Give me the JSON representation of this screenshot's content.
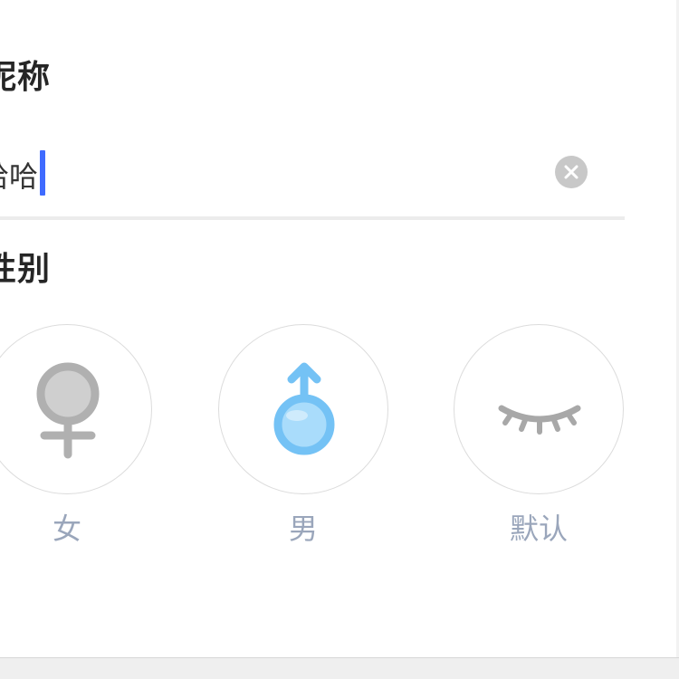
{
  "nickname": {
    "title": "昵称",
    "value": "哈哈",
    "clear_icon": "clear-icon",
    "cursor_color": "#3f6bff"
  },
  "gender": {
    "title": "性别",
    "options": [
      {
        "label": "女",
        "icon": "female-symbol-icon",
        "selected": false
      },
      {
        "label": "男",
        "icon": "male-symbol-icon",
        "selected": true
      },
      {
        "label": "默认",
        "icon": "closed-eye-icon",
        "selected": false
      }
    ],
    "selected_color": "#7cc8f7",
    "unselected_color": "#b0b0b0",
    "label_color": "#9aa6bb"
  }
}
